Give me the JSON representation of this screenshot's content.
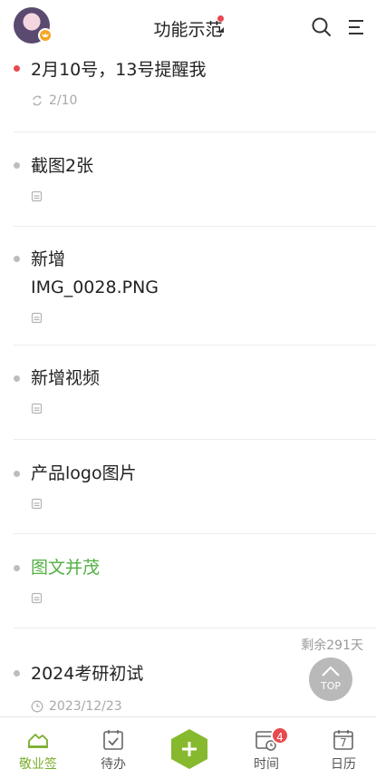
{
  "header": {
    "title": "功能示范"
  },
  "items": [
    {
      "title": "2月10号，13号提醒我",
      "meta": "2/10",
      "meta_icon": "repeat-icon",
      "bullet": "red"
    },
    {
      "title": "截图2张",
      "meta": "",
      "meta_icon": "attachment-icon",
      "bullet": "gray"
    },
    {
      "title_line1": "新增",
      "title_line2": "IMG_0028.PNG",
      "meta": "",
      "meta_icon": "attachment-icon",
      "bullet": "gray"
    },
    {
      "title": "新增视频",
      "meta": "",
      "meta_icon": "attachment-icon",
      "bullet": "gray"
    },
    {
      "title": "产品logo图片",
      "meta": "",
      "meta_icon": "attachment-icon",
      "bullet": "gray"
    },
    {
      "title": "图文并茂",
      "meta": "",
      "meta_icon": "attachment-icon",
      "bullet": "gray",
      "title_color": "#52b043"
    },
    {
      "title": "2024考研初试",
      "meta": "2023/12/23",
      "meta_icon": "clock-icon",
      "bullet": "gray",
      "remain": "剩余291天"
    }
  ],
  "top_button": {
    "label": "TOP"
  },
  "tabbar": {
    "tabs": [
      {
        "label": "敬业签",
        "icon": "home-icon",
        "active": true
      },
      {
        "label": "待办",
        "icon": "todo-icon"
      },
      {
        "label": "",
        "icon": "add-icon"
      },
      {
        "label": "时间",
        "icon": "time-icon",
        "badge": "4"
      },
      {
        "label": "日历",
        "icon": "calendar-icon",
        "day": "7"
      }
    ]
  },
  "colors": {
    "accent": "#79ad2b",
    "add_button": "#86b92e",
    "alert": "#e8484e",
    "green_text": "#52b043"
  }
}
